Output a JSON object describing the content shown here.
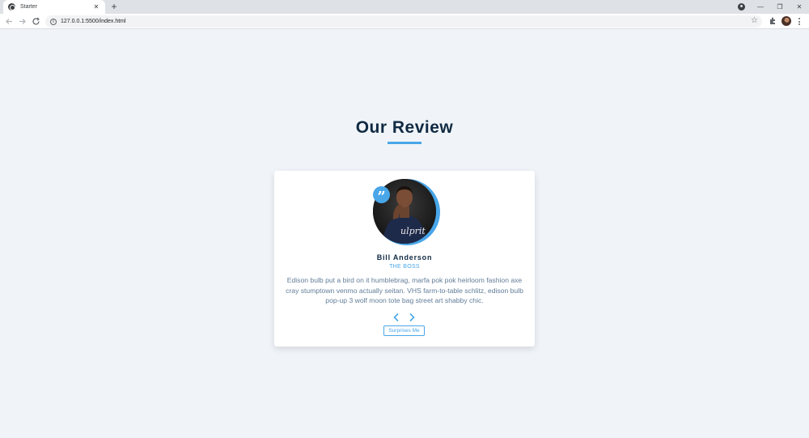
{
  "browser": {
    "tab_title": "Starter",
    "tab_close": "✕",
    "new_tab": "+",
    "url": "127.0.0.1:5500/index.html",
    "back_icon": "arrow-left-icon",
    "forward_icon": "arrow-right-icon",
    "reload_icon": "reload-icon",
    "bookmark_star": "☆",
    "window_controls": {
      "minimize": "—",
      "restore": "❐",
      "close": "✕"
    }
  },
  "section": {
    "title": "Our Review"
  },
  "review": {
    "author": "Bill Anderson",
    "job": "THE BOSS",
    "info": "Edison bulb put a bird on it humblebrag, marfa pok pok heirloom fashion axe cray stumptown venmo actually seitan. VHS farm-to-table schlitz, edison bulb pop-up 3 wolf moon tote bag street art shabby chic.",
    "quote_mark": "”",
    "shirt_text": "ulprit",
    "random_button_label": "Surprises Me"
  },
  "colors": {
    "accent": "#49a6e9",
    "title": "#102a43",
    "text": "#627d98",
    "background": "#f0f4f8"
  }
}
